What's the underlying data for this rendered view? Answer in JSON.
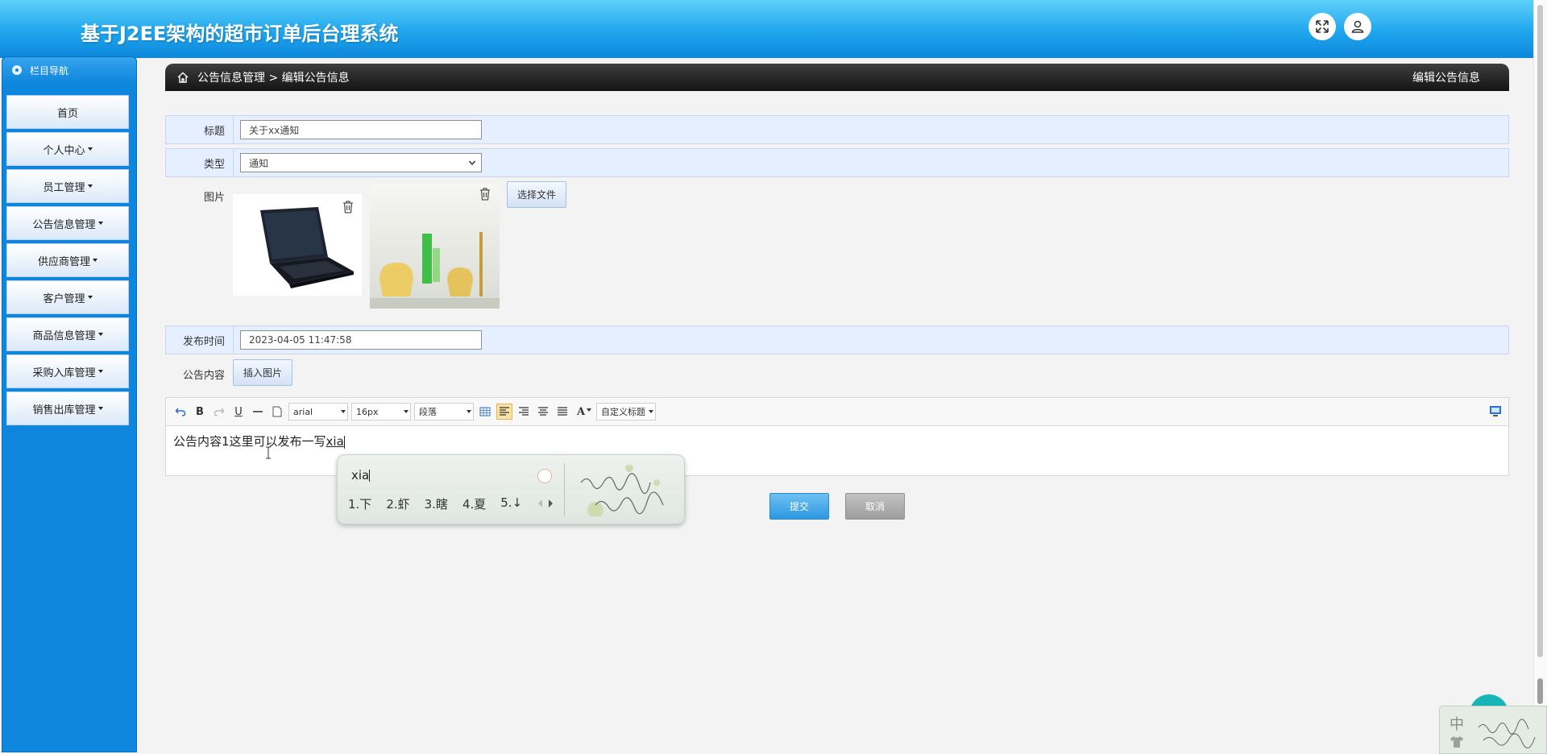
{
  "header": {
    "title": "基于J2EE架构的超市订单后台理系统",
    "fullscreen_icon": "expand-arrows-icon",
    "user_icon": "user-icon"
  },
  "sidebar": {
    "heading": "栏目导航",
    "items": [
      {
        "label": "首页",
        "dropdown": false
      },
      {
        "label": "个人中心",
        "dropdown": true
      },
      {
        "label": "员工管理",
        "dropdown": true
      },
      {
        "label": "公告信息管理",
        "dropdown": true
      },
      {
        "label": "供应商管理",
        "dropdown": true
      },
      {
        "label": "客户管理",
        "dropdown": true
      },
      {
        "label": "商品信息管理",
        "dropdown": true
      },
      {
        "label": "采购入库管理",
        "dropdown": true
      },
      {
        "label": "销售出库管理",
        "dropdown": true
      }
    ]
  },
  "breadcrumb": {
    "path": "公告信息管理 > 编辑公告信息",
    "page_title": "编辑公告信息"
  },
  "form": {
    "title_label": "标题",
    "title_value": "关于xx通知",
    "type_label": "类型",
    "type_value": "通知",
    "image_label": "图片",
    "choose_file": "选择文件",
    "publish_label": "发布时间",
    "publish_value": "2023-04-05 11:47:58",
    "content_label": "公告内容",
    "insert_image": "插入图片"
  },
  "editor": {
    "font_family": "arial",
    "font_size": "16px",
    "paragraph": "段落",
    "custom_title": "自定义标题",
    "content_text": "公告内容1这里可以发布一写",
    "composing": "xia"
  },
  "ime": {
    "pinyin": "xia",
    "candidates": [
      "1.下",
      "2.虾",
      "3.瞎",
      "4.夏",
      "5.↓"
    ],
    "indicator": "中"
  },
  "actions": {
    "submit": "提交",
    "cancel": "取消"
  },
  "colors": {
    "header_blue": "#1fa6ee",
    "sidebar_blue": "#0f86dd",
    "submit_blue": "#3fa5e8",
    "cancel_gray": "#a9a9a9"
  }
}
